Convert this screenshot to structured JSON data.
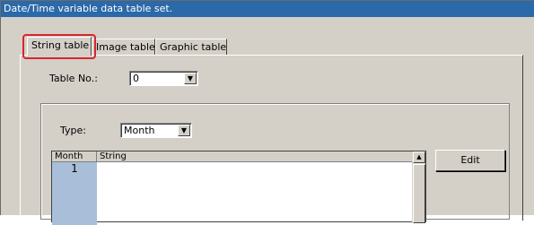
{
  "window": {
    "title": "Date/Time variable data table set."
  },
  "tabs": [
    {
      "label": "String table",
      "active": true
    },
    {
      "label": "Image table",
      "active": false
    },
    {
      "label": "Graphic table",
      "active": false
    }
  ],
  "table_no": {
    "label": "Table No.:",
    "value": "0"
  },
  "type": {
    "label": "Type:",
    "value": "Month"
  },
  "grid": {
    "columns": [
      "Month",
      "String"
    ],
    "rows": [
      {
        "month": "1",
        "string": ""
      }
    ]
  },
  "edit_button": {
    "label": "Edit"
  },
  "colors": {
    "title_bar": "#2b69a8",
    "highlight": "#d8262f",
    "selected_cell": "#a9bfd9"
  }
}
